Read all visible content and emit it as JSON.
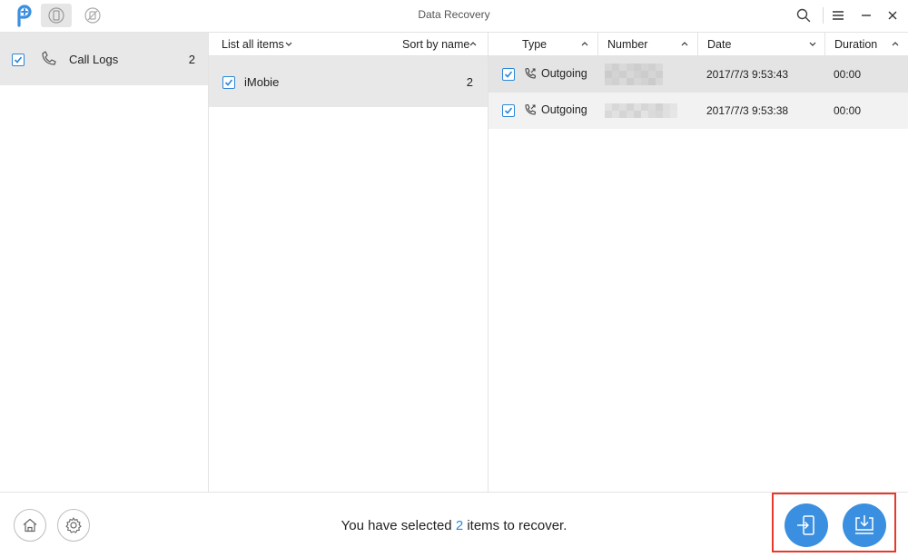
{
  "window": {
    "title": "Data Recovery"
  },
  "categories": [
    {
      "label": "Call Logs",
      "count": "2",
      "checked": true
    }
  ],
  "contacts_panel": {
    "filter_label": "List all items",
    "sort_label": "Sort by name",
    "items": [
      {
        "label": "iMobie",
        "count": "2",
        "checked": true
      }
    ]
  },
  "logs_panel": {
    "columns": {
      "type": "Type",
      "number": "Number",
      "date": "Date",
      "duration": "Duration"
    },
    "rows": [
      {
        "type": "Outgoing",
        "date": "2017/7/3 9:53:43",
        "duration": "00:00",
        "checked": true
      },
      {
        "type": "Outgoing",
        "date": "2017/7/3 9:53:38",
        "duration": "00:00",
        "checked": true
      }
    ]
  },
  "footer": {
    "status_prefix": "You have selected",
    "selected_count": "2",
    "status_suffix": "items to recover."
  },
  "colors": {
    "accent": "#2b87d8",
    "action_button": "#3a8fe0",
    "highlight_box": "#e8382b",
    "selected_row": "#e8e8e8"
  },
  "icons": {
    "logo": "phonerescue-logo-icon",
    "mode_device": "device-recovery-icon",
    "mode_backup": "backup-recovery-icon",
    "search": "search-icon",
    "menu": "menu-icon",
    "minimize": "minimize-icon",
    "close": "close-icon",
    "home": "home-icon",
    "settings": "gear-icon",
    "to_device": "recover-to-device-icon",
    "to_computer": "recover-to-computer-icon"
  }
}
